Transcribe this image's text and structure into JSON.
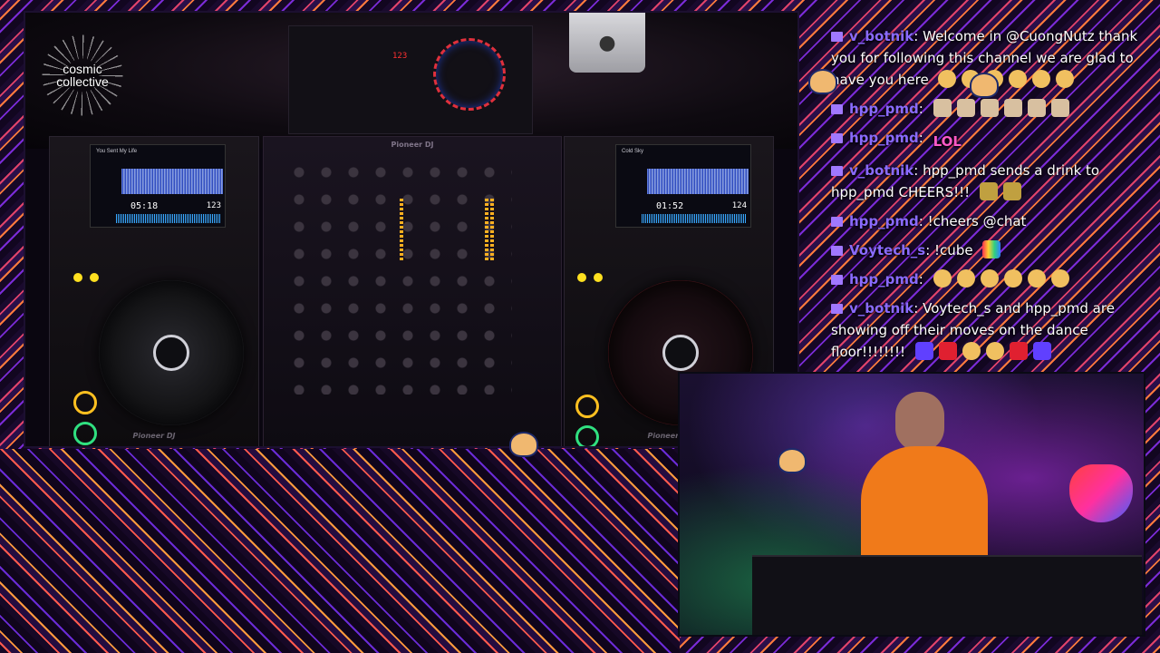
{
  "logo": {
    "line1": "cosmic",
    "line2": "collective"
  },
  "deck_left": {
    "track": "You Sent My Life",
    "time": "05:18",
    "bpm": "123"
  },
  "deck_right": {
    "track": "Cold Sky",
    "time": "01:52",
    "bpm": "124"
  },
  "fx_display": "123",
  "brand_mixer": "Pioneer DJ",
  "brand_player": "Pioneer DJ",
  "chat": [
    {
      "user": "v_botnik",
      "text": "Welcome in @CuongNutz thank you for following this channel we are glad to have you here",
      "emotes": [
        "hand",
        "hand",
        "hand",
        "hand",
        "hand",
        "hand"
      ]
    },
    {
      "user": "hpp_pmd",
      "text": "",
      "emotes": [
        "face",
        "face",
        "face",
        "face",
        "face",
        "face"
      ]
    },
    {
      "user": "hpp_pmd",
      "text": "",
      "lol": "LOL"
    },
    {
      "user": "v_botnik",
      "text": "hpp_pmd sends a drink to hpp_pmd CHEERS!!!",
      "emotes": [
        "beer",
        "beer"
      ]
    },
    {
      "user": "hpp_pmd",
      "text": "!cheers @chat",
      "emotes": []
    },
    {
      "user": "Voytech_s",
      "text": "!cube",
      "emotes": [
        "heart-rainbow"
      ]
    },
    {
      "user": "hpp_pmd",
      "text": "",
      "emotes": [
        "hand",
        "hand",
        "hand",
        "hand",
        "hand",
        "hand"
      ]
    },
    {
      "user": "v_botnik",
      "text": "Voytech_s and hpp_pmd are showing off their moves on the dance floor!!!!!!!!",
      "emotes": [
        "go",
        "hearts",
        "hand",
        "hand",
        "hearts",
        "go"
      ]
    }
  ]
}
